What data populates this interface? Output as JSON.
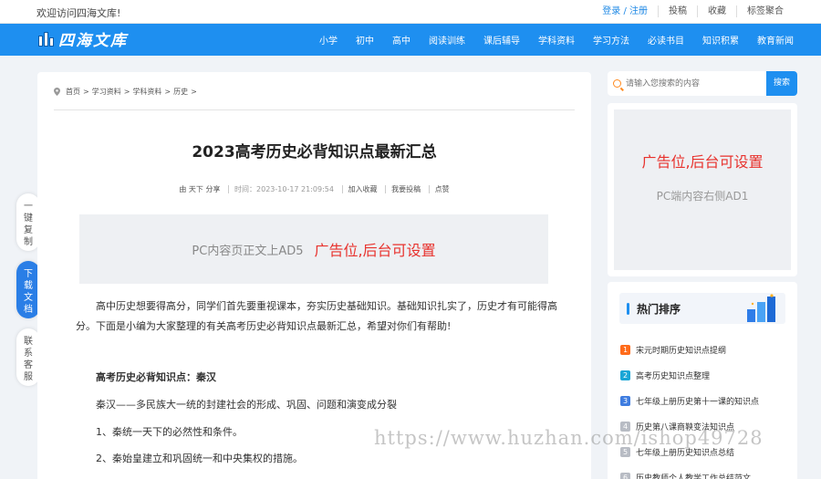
{
  "topbar": {
    "welcome": "欢迎访问四海文库!",
    "login": "登录 / 注册",
    "links": [
      "投稿",
      "收藏",
      "标签聚合"
    ]
  },
  "logo": {
    "text": "四海文库"
  },
  "nav": [
    "小学",
    "初中",
    "高中",
    "阅读训练",
    "课后辅导",
    "学科资料",
    "学习方法",
    "必读书目",
    "知识积累",
    "教育新闻"
  ],
  "floaters": {
    "copy": "一键复制",
    "download": "下载文档",
    "service": "联系客服"
  },
  "breadcrumb": [
    "首页",
    "学习资料",
    "学科资料",
    "历史"
  ],
  "breadcrumb_sep": ">",
  "article": {
    "title": "2023高考历史必背知识点最新汇总",
    "author": "由 天下 分享",
    "time": "时间：2023-10-17 21:09:54",
    "actions": [
      "加入收藏",
      "我要投稿",
      "点赞"
    ],
    "ad_small": "PC内容页正文上AD5",
    "ad_big": "广告位,后台可设置",
    "intro": "高中历史想要得高分，同学们首先要重视课本，夯实历史基础知识。基础知识扎实了，历史才有可能得高分。下面是小编为大家整理的有关高考历史必背知识点最新汇总，希望对你们有帮助!",
    "heading": "高考历史必背知识点：秦汉",
    "line1": "秦汉——多民族大一统的封建社会的形成、巩固、问题和演变成分裂",
    "line2": "1、秦统一天下的必然性和条件。",
    "line3": "2、秦始皇建立和巩固统一和中央集权的措施。"
  },
  "search": {
    "placeholder": "请输入您搜索的内容",
    "button": "搜索"
  },
  "side_ad": {
    "big": "广告位,后台可设置",
    "small": "PC端内容右侧AD1"
  },
  "hot": {
    "title": "热门排序",
    "items": [
      {
        "num": "1",
        "text": "宋元时期历史知识点提纲",
        "color": "#ff6b1a"
      },
      {
        "num": "2",
        "text": "高考历史知识点整理",
        "color": "#1aa6d6"
      },
      {
        "num": "3",
        "text": "七年级上册历史第十一课的知识点",
        "color": "#3f7de0"
      },
      {
        "num": "4",
        "text": "历史第八课商鞅变法知识点",
        "color": "#b8bcc4"
      },
      {
        "num": "5",
        "text": "七年级上册历史知识点总结",
        "color": "#b8bcc4"
      },
      {
        "num": "6",
        "text": "历史教师个人教学工作总结范文",
        "color": "#b8bcc4"
      }
    ]
  },
  "watermark": "https://www.huzhan.com/ishop49728"
}
